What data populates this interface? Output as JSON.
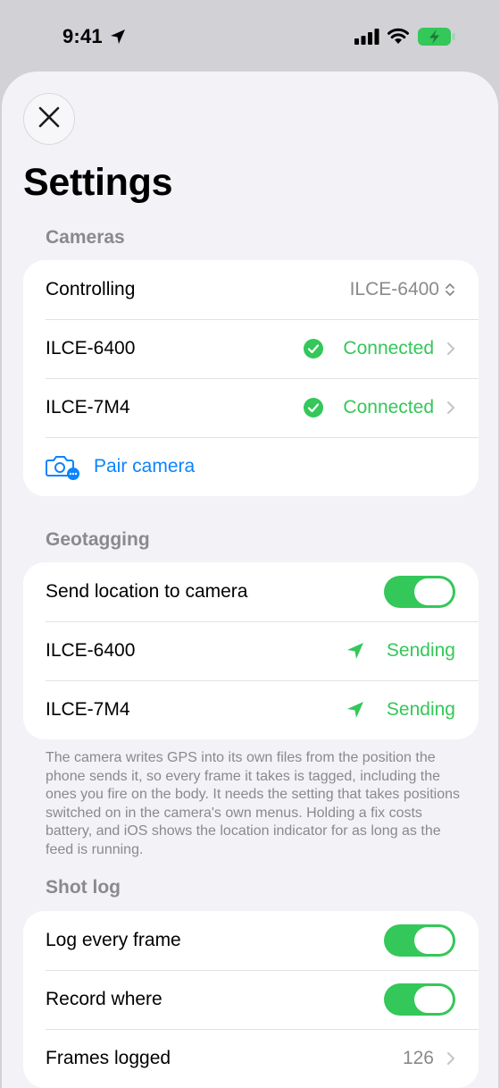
{
  "status_bar": {
    "time": "9:41"
  },
  "page": {
    "title": "Settings"
  },
  "cameras": {
    "header": "Cameras",
    "controlling_label": "Controlling",
    "controlling_value": "ILCE-6400",
    "devices": [
      {
        "name": "ILCE-6400",
        "status": "Connected"
      },
      {
        "name": "ILCE-7M4",
        "status": "Connected"
      }
    ],
    "pair_label": "Pair camera"
  },
  "geotagging": {
    "header": "Geotagging",
    "send_label": "Send location to camera",
    "send_enabled": true,
    "devices": [
      {
        "name": "ILCE-6400",
        "status": "Sending"
      },
      {
        "name": "ILCE-7M4",
        "status": "Sending"
      }
    ],
    "footnote": "The camera writes GPS into its own files from the position the phone sends it, so every frame it takes is tagged, including the ones you fire on the body. It needs the setting that takes positions switched on in the camera's own menus. Holding a fix costs battery, and iOS shows the location indicator for as long as the feed is running."
  },
  "shot_log": {
    "header": "Shot log",
    "log_every_frame_label": "Log every frame",
    "log_every_frame_enabled": true,
    "record_where_label": "Record where",
    "record_where_enabled": true,
    "frames_logged_label": "Frames logged",
    "frames_logged_value": "126"
  },
  "colors": {
    "accent_green": "#34c759",
    "accent_blue": "#0a84ff",
    "secondary_text": "#8a8a8e"
  }
}
